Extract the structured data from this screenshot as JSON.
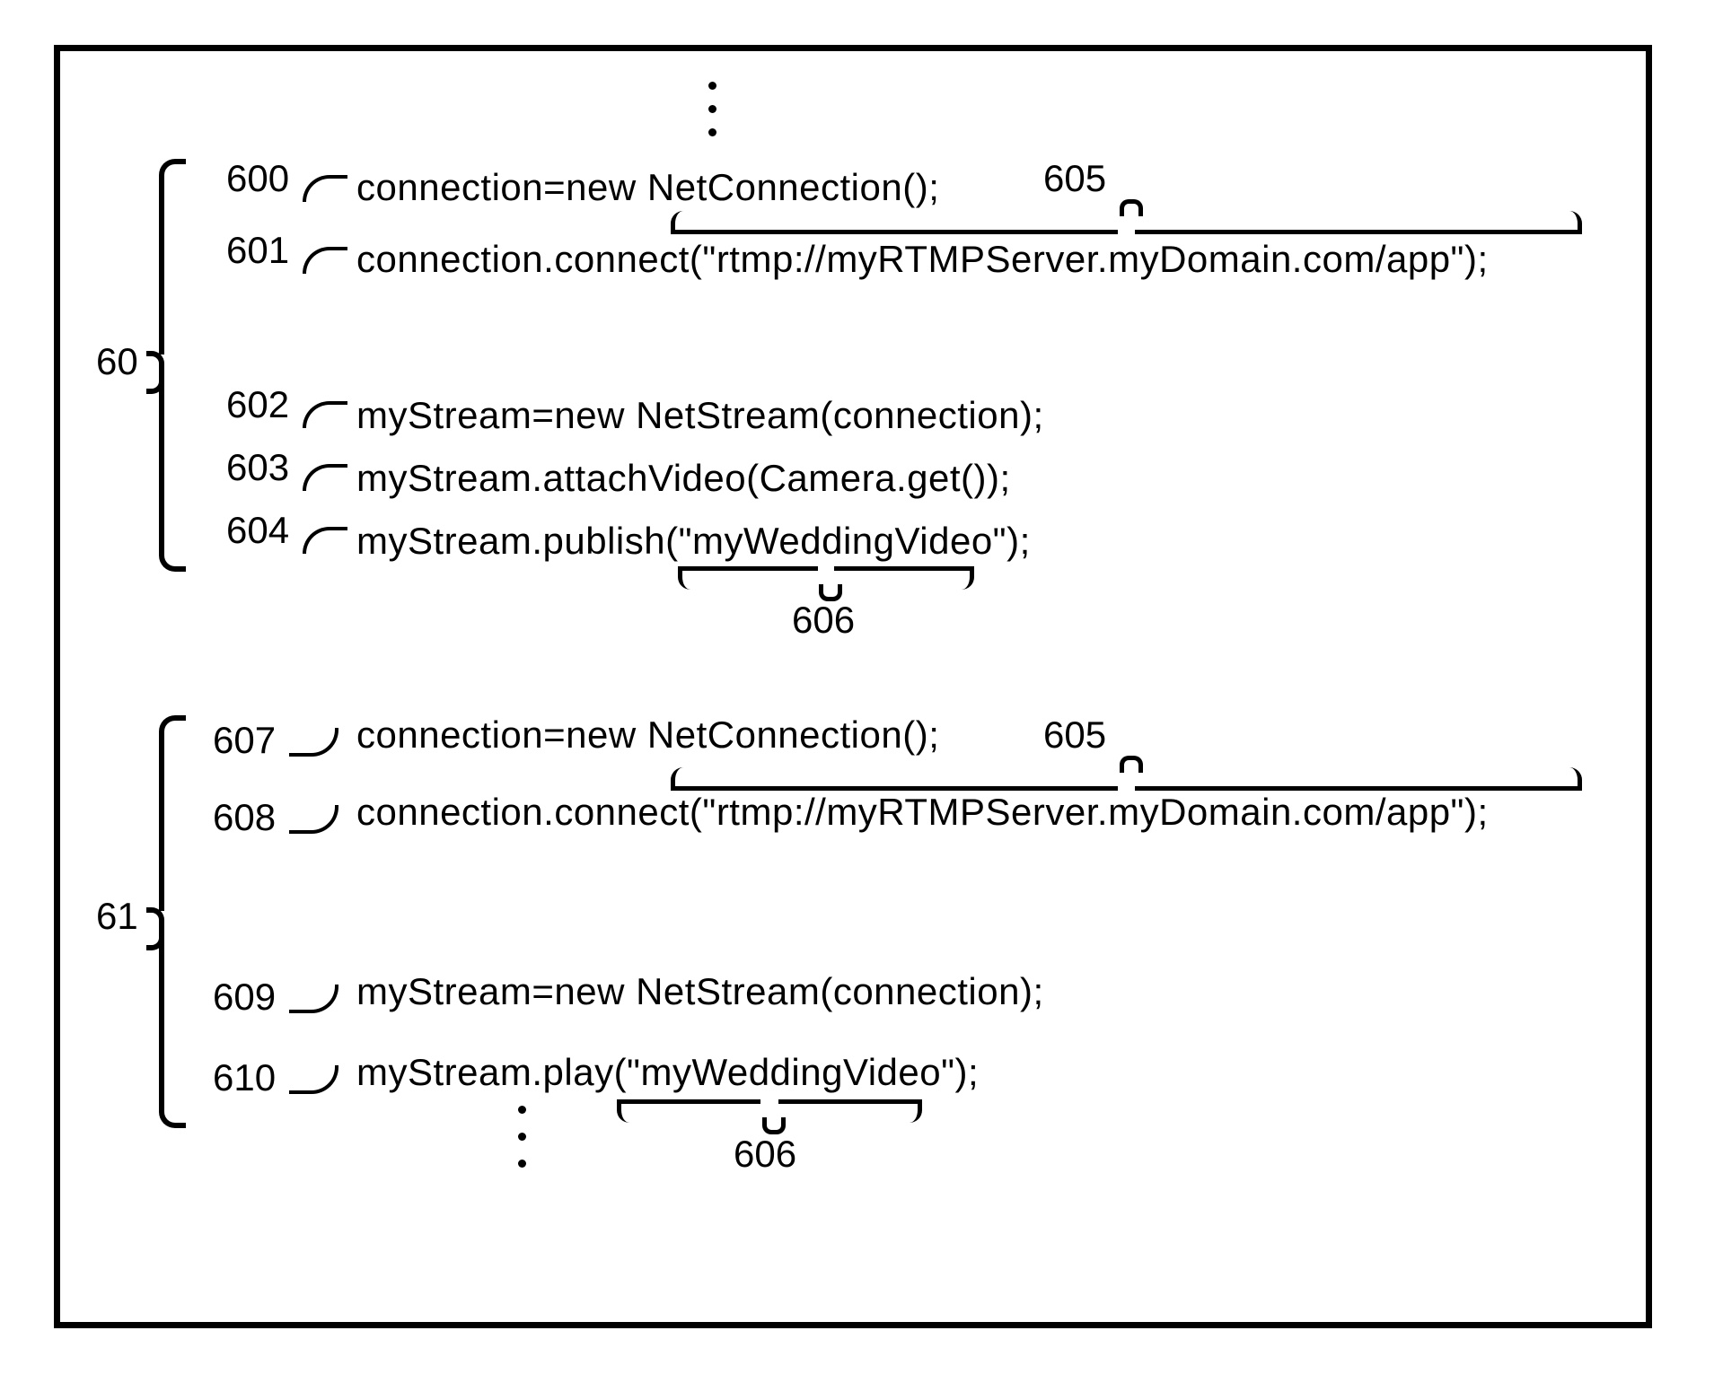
{
  "block60": {
    "label": "60",
    "lines": {
      "l600": {
        "ref": "600",
        "code": "connection=new  NetConnection();"
      },
      "l601": {
        "ref": "601",
        "code": "connection.connect(\"rtmp://myRTMPServer.myDomain.com/app\");"
      },
      "l602": {
        "ref": "602",
        "code": "myStream=new  NetStream(connection);"
      },
      "l603": {
        "ref": "603",
        "code": "myStream.attachVideo(Camera.get());"
      },
      "l604": {
        "ref": "604",
        "code": "myStream.publish(\"myWeddingVideo\");"
      }
    },
    "callouts": {
      "c605": "605",
      "c606": "606"
    }
  },
  "block61": {
    "label": "61",
    "lines": {
      "l607": {
        "ref": "607",
        "code": "connection=new  NetConnection();"
      },
      "l608": {
        "ref": "608",
        "code": "connection.connect(\"rtmp://myRTMPServer.myDomain.com/app\");"
      },
      "l609": {
        "ref": "609",
        "code": "myStream=new  NetStream(connection);"
      },
      "l610": {
        "ref": "610",
        "code": "myStream.play(\"myWeddingVideo\");"
      }
    },
    "callouts": {
      "c605": "605",
      "c606": "606"
    }
  }
}
